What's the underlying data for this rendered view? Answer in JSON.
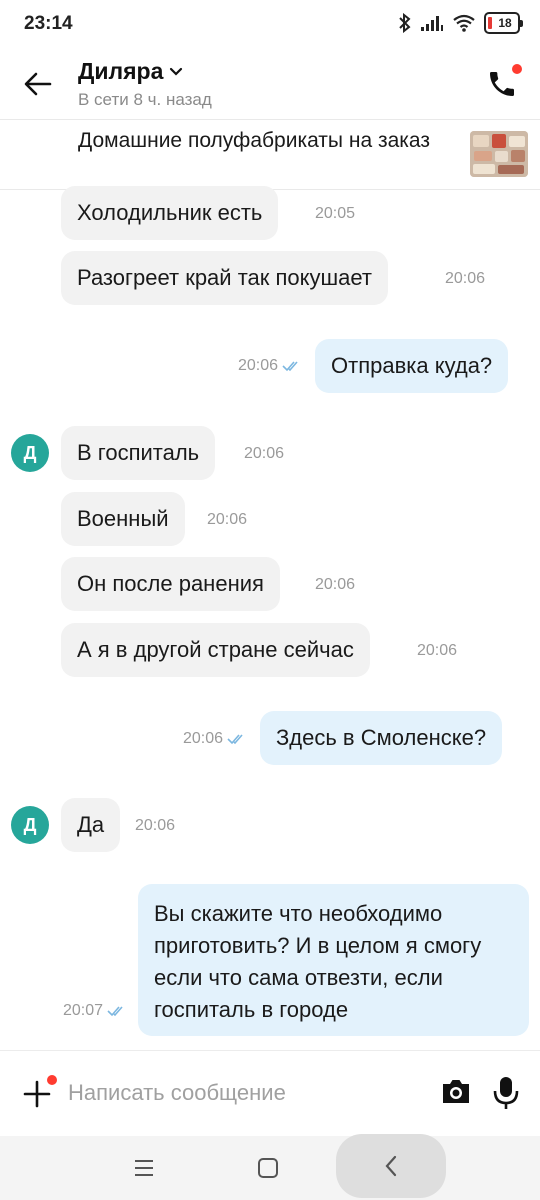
{
  "status_bar": {
    "time": "23:14",
    "battery_level": "18",
    "icons": [
      "bluetooth-icon",
      "signal-icon",
      "wifi-icon",
      "battery-icon"
    ]
  },
  "header": {
    "contact_name": "Диляра",
    "contact_status": "В сети 8 ч. назад"
  },
  "listing": {
    "title": "Домашние полуфабрикаты на заказ"
  },
  "messages": [
    {
      "direction": "in",
      "text": "Холодильник есть",
      "time": "20:05"
    },
    {
      "direction": "in",
      "text": "Разогреет край так покушает",
      "time": "20:06"
    },
    {
      "direction": "out",
      "text": "Отправка куда?",
      "time": "20:06",
      "read": true
    },
    {
      "direction": "in",
      "text": "В госпиталь",
      "time": "20:06",
      "avatar": "Д"
    },
    {
      "direction": "in",
      "text": "Военный",
      "time": "20:06"
    },
    {
      "direction": "in",
      "text": "Он после ранения",
      "time": "20:06"
    },
    {
      "direction": "in",
      "text": "А я в другой стране сейчас",
      "time": "20:06"
    },
    {
      "direction": "out",
      "text": "Здесь в Смоленске?",
      "time": "20:06",
      "read": true
    },
    {
      "direction": "in",
      "text": "Да",
      "time": "20:06",
      "avatar": "Д"
    },
    {
      "direction": "out",
      "text": "Вы скажите что необходимо приготовить? И в целом я смогу если что сама отвезти, если госпиталь в городе",
      "time": "20:07",
      "read": true
    }
  ],
  "input": {
    "placeholder": "Написать сообщение"
  },
  "colors": {
    "incoming_bubble": "#f2f2f2",
    "outgoing_bubble": "#e3f2fc",
    "avatar": "#26a69a",
    "read_check": "#7cb7e0",
    "notification_dot": "#ff3b30"
  }
}
